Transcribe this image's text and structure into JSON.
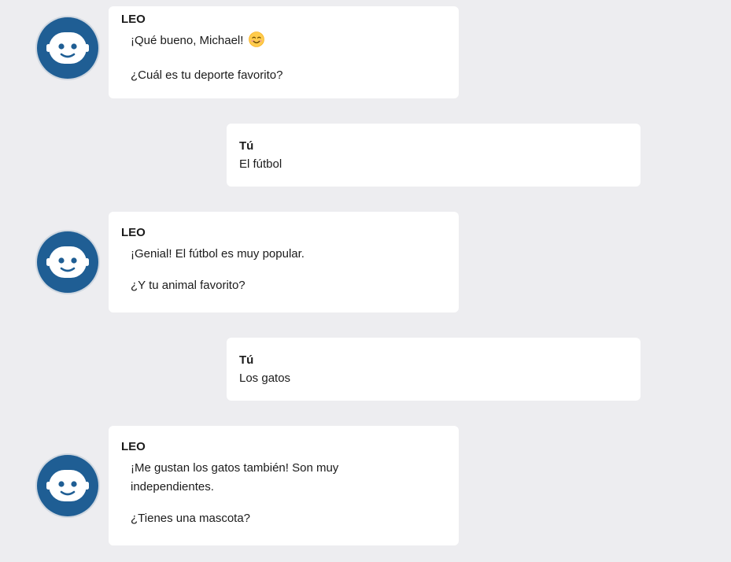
{
  "messages": [
    {
      "role": "bot",
      "sender": "LEO",
      "paragraphs": [
        "¡Qué bueno, Michael!",
        "¿Cuál es tu deporte favorito?"
      ],
      "emoji": "smiling-face-emoji"
    },
    {
      "role": "user",
      "sender": "Tú",
      "text": "El fútbol"
    },
    {
      "role": "bot",
      "sender": "LEO",
      "paragraphs": [
        "¡Genial! El fútbol es muy popular.",
        "¿Y tu animal favorito?"
      ]
    },
    {
      "role": "user",
      "sender": "Tú",
      "text": "Los gatos"
    },
    {
      "role": "bot",
      "sender": "LEO",
      "paragraphs": [
        "¡Me gustan los gatos también! Son muy independientes.",
        "¿Tienes una mascota?"
      ]
    }
  ],
  "avatar": {
    "icon": "robot-face-icon",
    "background_color": "#1f5e94"
  }
}
